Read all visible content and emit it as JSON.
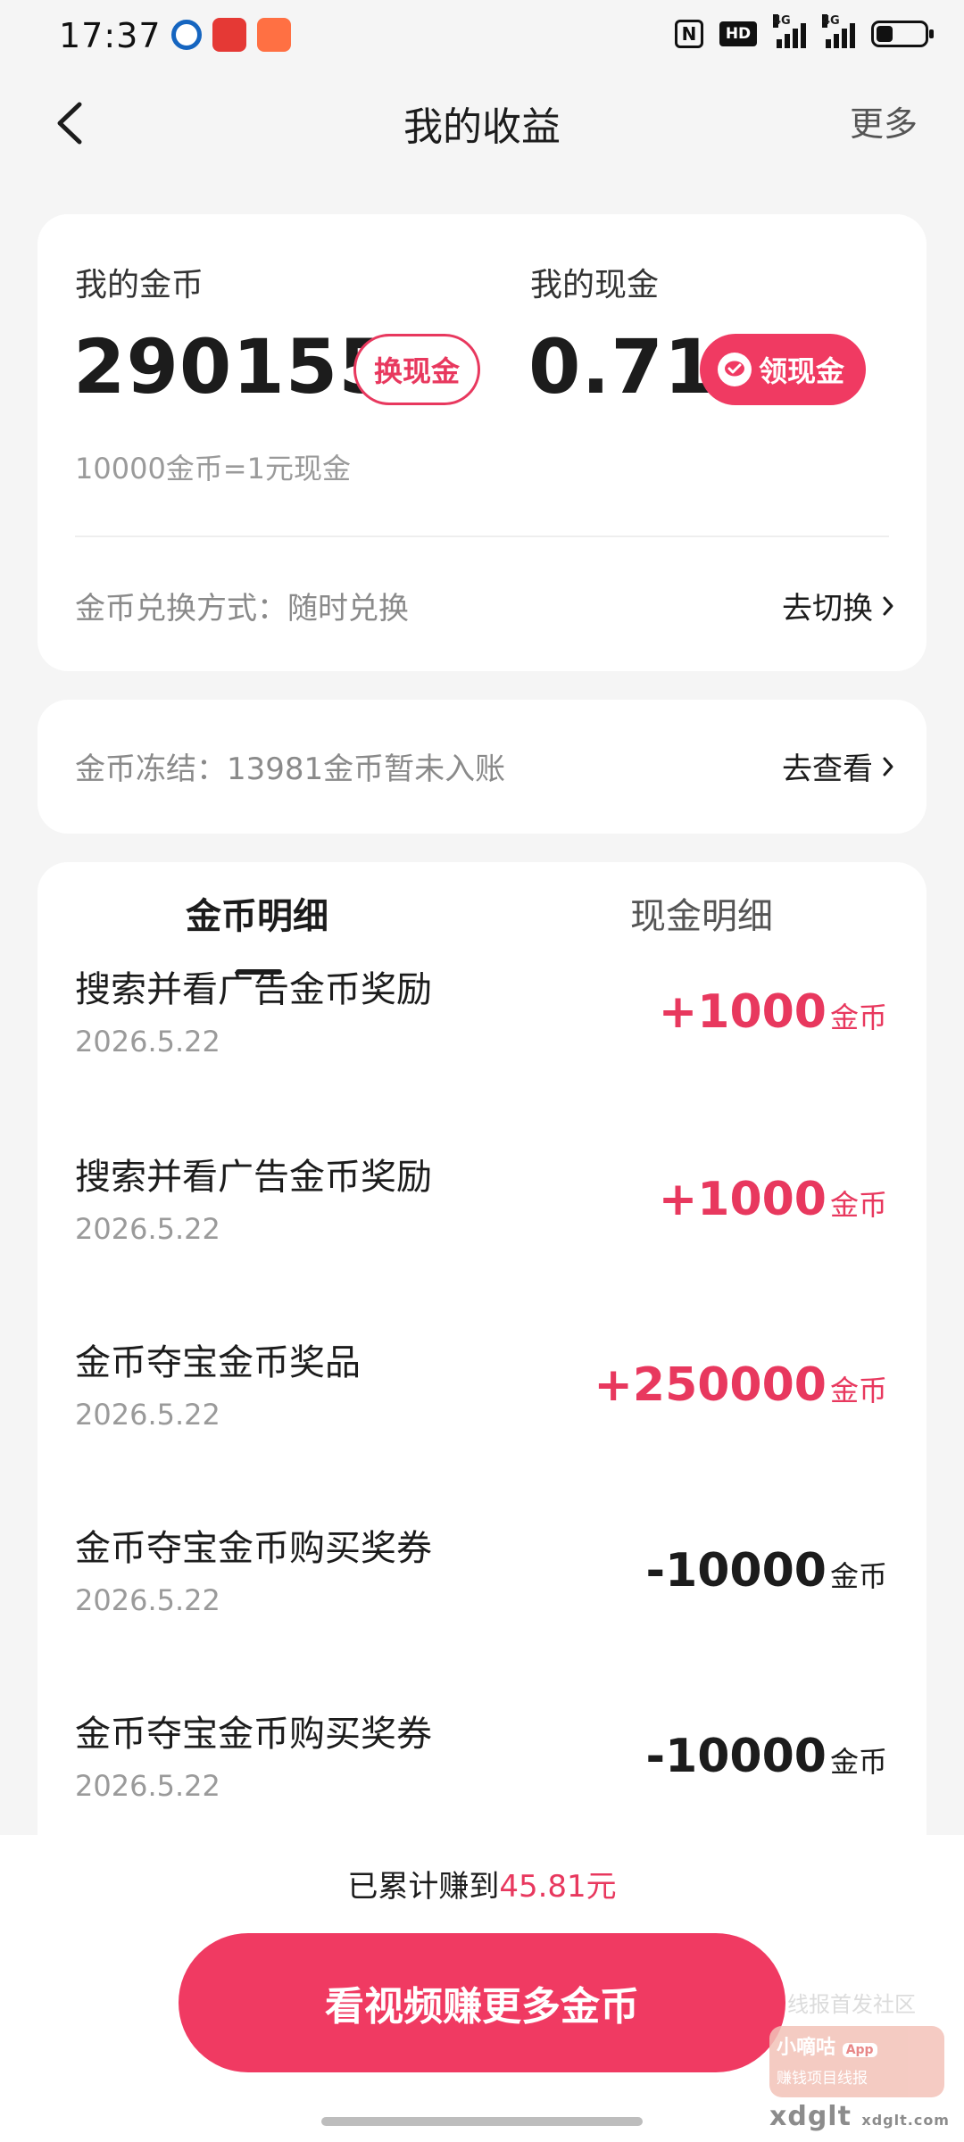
{
  "status_bar": {
    "time": "17:37",
    "app_icons": [
      "bank-app-icon",
      "unionpay-app-icon",
      "video-app-icon"
    ],
    "indicators": [
      "nfc-icon",
      "hd-icon",
      "signal-4g-icon",
      "signal-4g-icon",
      "battery-icon"
    ],
    "hd_label": "HD",
    "net_label_1": "4G",
    "net_label_2": "4G"
  },
  "header": {
    "title": "我的收益",
    "more_label": "更多"
  },
  "balance": {
    "coins_label": "我的金币",
    "coins_value": "290155",
    "exchange_button": "换现金",
    "cash_label": "我的现金",
    "cash_value": "0.71",
    "withdraw_button": "领现金",
    "rate_text": "10000金币=1元现金",
    "method_text": "金币兑换方式：随时兑换",
    "switch_link": "去切换"
  },
  "frozen": {
    "text": "金币冻结：13981金币暂未入账",
    "view_link": "去查看"
  },
  "tabs": {
    "coins_tab": "金币明细",
    "cash_tab": "现金明细",
    "active": "coins"
  },
  "transactions": [
    {
      "title": "搜索并看广告金币奖励",
      "date": "2026.5.22",
      "amount": "+1000",
      "unit": "金币",
      "sign": "positive"
    },
    {
      "title": "搜索并看广告金币奖励",
      "date": "2026.5.22",
      "amount": "+1000",
      "unit": "金币",
      "sign": "positive"
    },
    {
      "title": "金币夺宝金币奖品",
      "date": "2026.5.22",
      "amount": "+250000",
      "unit": "金币",
      "sign": "positive"
    },
    {
      "title": "金币夺宝金币购买奖券",
      "date": "2026.5.22",
      "amount": "-10000",
      "unit": "金币",
      "sign": "negative"
    },
    {
      "title": "金币夺宝金币购买奖券",
      "date": "2026.5.22",
      "amount": "-10000",
      "unit": "金币",
      "sign": "negative"
    }
  ],
  "footer": {
    "earned_prefix": "已累计赚到",
    "earned_amount": "45.81元",
    "cta_button": "看视频赚更多金币"
  },
  "watermark": {
    "line1": "线报首发社区",
    "logo_title": "小嘀咕",
    "logo_badge": "App",
    "logo_sub": "赚钱项目线报",
    "domain": "xdglt",
    "domain_small": "xdglt.com"
  },
  "colors": {
    "accent": "#f03a62",
    "accent_text": "#e8385e",
    "background": "#f5f5f5",
    "card": "#ffffff"
  }
}
